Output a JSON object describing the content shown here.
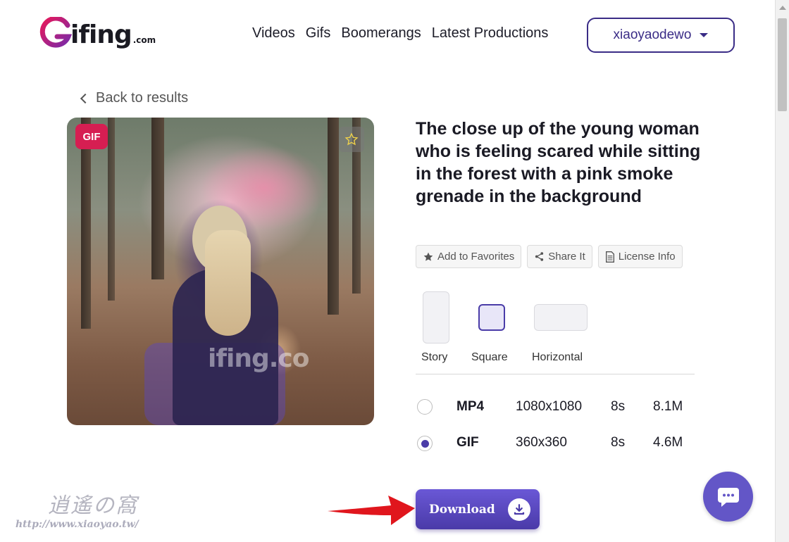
{
  "header": {
    "logo_word": "ifing",
    "logo_suffix": ".com",
    "nav": [
      "Videos",
      "Gifs",
      "Boomerangs",
      "Latest Productions"
    ],
    "user_name": "xiaoyaodewo"
  },
  "back_label": "Back to results",
  "preview": {
    "badge": "GIF",
    "watermark": "ifing.co",
    "favorite_icon": "star-icon"
  },
  "title": "The close up of the young woman who is feeling scared while sitting in the forest with a pink smoke grenade in the background",
  "actions": [
    {
      "label": "Add to Favorites",
      "icon": "star-icon"
    },
    {
      "label": "Share It",
      "icon": "share-icon"
    },
    {
      "label": "License Info",
      "icon": "document-icon"
    }
  ],
  "aspects": [
    {
      "label": "Story",
      "selected": false
    },
    {
      "label": "Square",
      "selected": true
    },
    {
      "label": "Horizontal",
      "selected": false
    }
  ],
  "formats": [
    {
      "format": "MP4",
      "resolution": "1080x1080",
      "duration": "8s",
      "size": "8.1M",
      "selected": false
    },
    {
      "format": "GIF",
      "resolution": "360x360",
      "duration": "8s",
      "size": "4.6M",
      "selected": true
    }
  ],
  "download_label": "Download",
  "colors": {
    "accent": "#4a3ca8",
    "brand_pink": "#d61e52",
    "arrow_red": "#e0161d"
  },
  "watermark": {
    "logo": "逍遙の窩",
    "url": "http://www.xiaoyao.tw/"
  }
}
